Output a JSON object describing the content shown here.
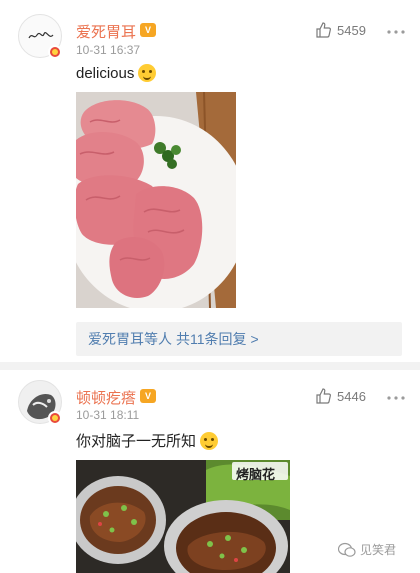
{
  "comments": [
    {
      "user": "爱死胃耳",
      "vip_badge": "V",
      "time": "10-31 16:37",
      "likes": "5459",
      "text": "delicious",
      "emoji": "smirk-emoji",
      "replies_author": "爱死胃耳等人",
      "replies_count": "共11条回复",
      "replies_arrow": ">"
    },
    {
      "user": "顿顿疙瘩",
      "vip_badge": "V",
      "time": "10-31 18:11",
      "likes": "5446",
      "text": "你对脑子一无所知",
      "emoji": "laugh-emoji",
      "photo_caption": "烤脑花"
    }
  ],
  "watermark": "见笑君",
  "colors": {
    "name": "#eb7350",
    "link": "#507daf",
    "muted": "#9b9b9b",
    "divider": "#f2f2f2"
  }
}
